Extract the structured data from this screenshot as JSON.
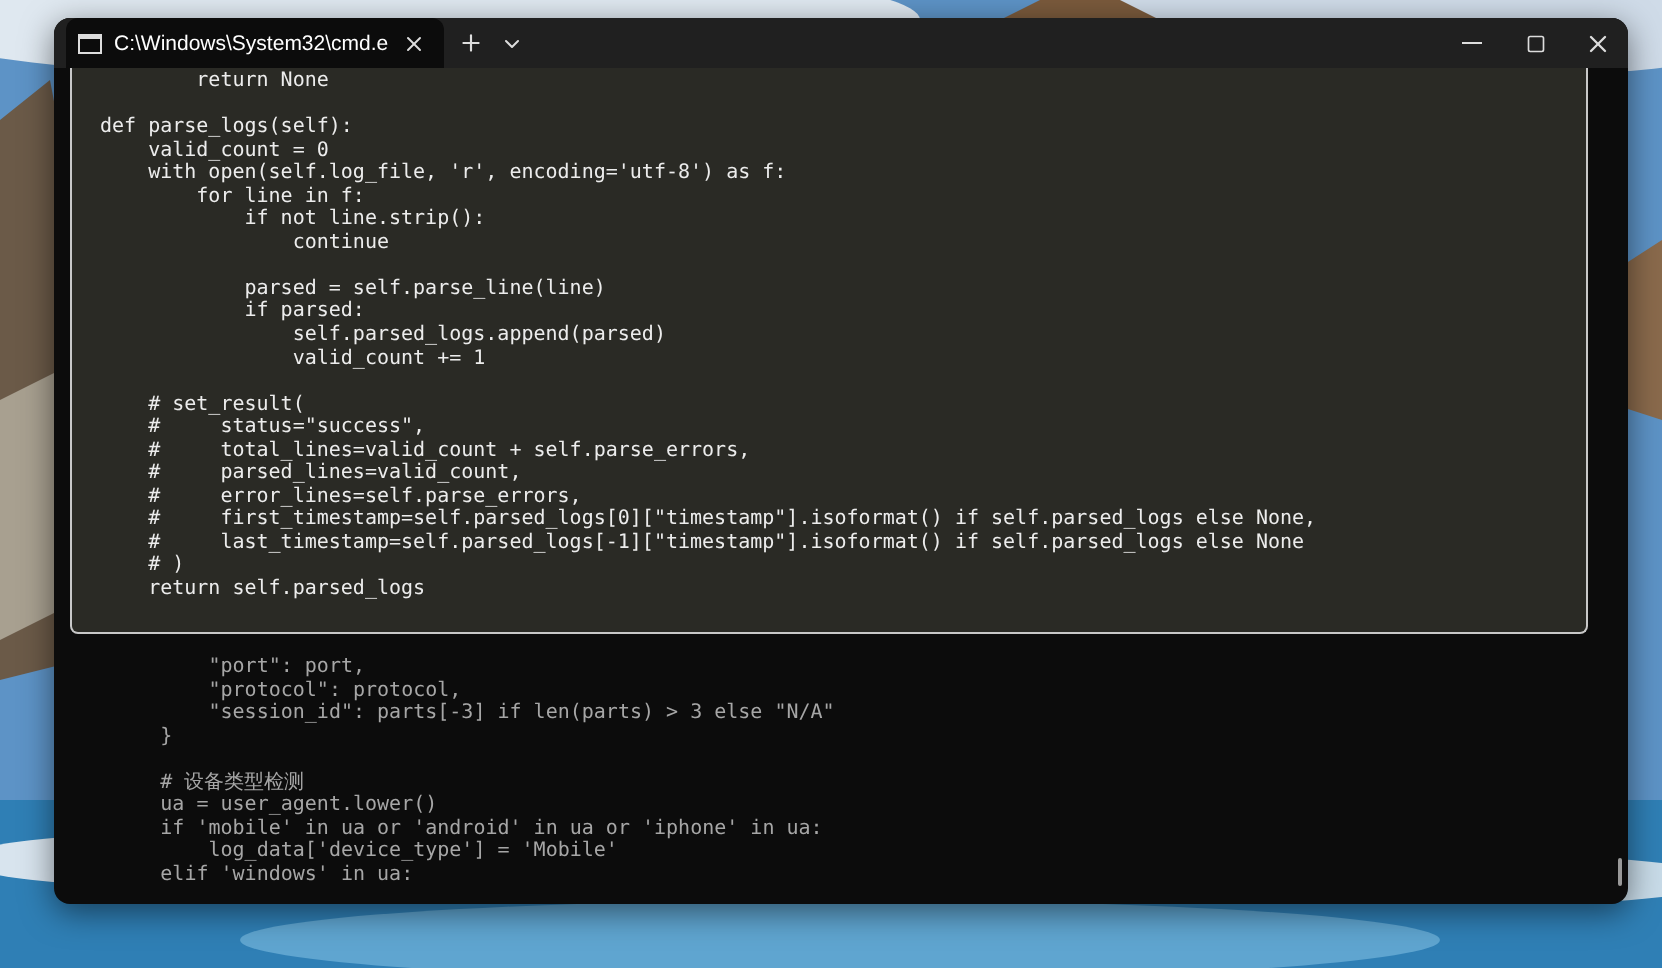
{
  "tab": {
    "title": "C:\\Windows\\System32\\cmd.e",
    "selected": true
  },
  "terminal_blocks": [
    [
      "            \"port\": port,",
      "            \"protocol\": protocol,",
      "            \"session_id\": parts[-3] if len(parts) > 3 else \"N/A\"",
      "        }"
    ],
    [
      "        # 设备类型检测",
      "        ua = user_agent.lower()",
      "        if 'mobile' in ua or 'android' in ua or 'iphone' in ua:",
      "            log_data['device_type'] = 'Mobile'",
      "        elif 'windows' in ua:"
    ]
  ],
  "code_panel_blocks": [
    [
      "        return None"
    ],
    [
      "def parse_logs(self):",
      "    valid_count = 0",
      "    with open(self.log_file, 'r', encoding='utf-8') as f:",
      "        for line in f:",
      "            if not line.strip():",
      "                continue"
    ],
    [
      "            parsed = self.parse_line(line)",
      "            if parsed:",
      "                self.parsed_logs.append(parsed)",
      "                valid_count += 1"
    ],
    [
      "    # set_result(",
      "    #     status=\"success\",",
      "    #     total_lines=valid_count + self.parse_errors,",
      "    #     parsed_lines=valid_count,",
      "    #     error_lines=self.parse_errors,",
      "    #     first_timestamp=self.parsed_logs[0][\"timestamp\"].isoformat() if self.parsed_logs else None,",
      "    #     last_timestamp=self.parsed_logs[-1][\"timestamp\"].isoformat() if self.parsed_logs else None",
      "    # )",
      "    return self.parsed_logs"
    ]
  ]
}
